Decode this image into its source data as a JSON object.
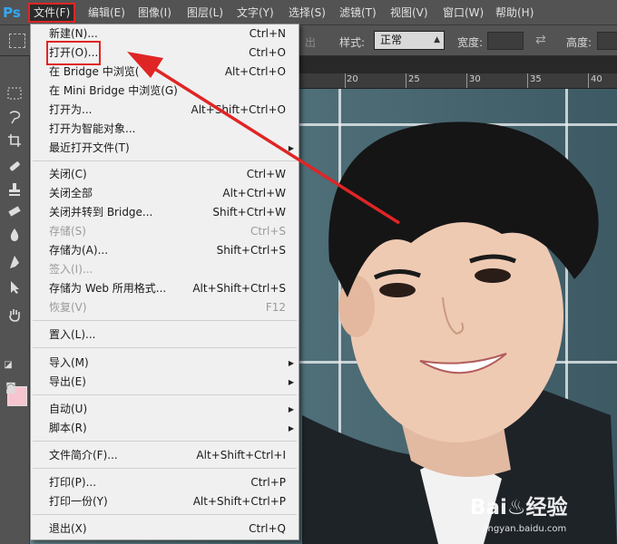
{
  "app": {
    "logo": "Ps"
  },
  "menubar": {
    "items": [
      "文件(F)",
      "编辑(E)",
      "图像(I)",
      "图层(L)",
      "文字(Y)",
      "选择(S)",
      "滤镜(T)",
      "视图(V)",
      "窗口(W)",
      "帮助(H)"
    ],
    "active": "文件(F)"
  },
  "options": {
    "partial_label": "出",
    "style_label": "样式:",
    "style_value": "正常",
    "width_label": "宽度:",
    "height_label": "高度:"
  },
  "ruler": {
    "ticks": [
      "20",
      "25",
      "30",
      "35",
      "40"
    ]
  },
  "file_menu": {
    "items": [
      {
        "label": "新建(N)...",
        "shortcut": "Ctrl+N"
      },
      {
        "label": "打开(O)...",
        "shortcut": "Ctrl+O",
        "highlight": true
      },
      {
        "label": "在 Bridge 中浏览(",
        "shortcut": "Alt+Ctrl+O"
      },
      {
        "label": "在 Mini Bridge 中浏览(G)",
        "shortcut": ""
      },
      {
        "label": "打开为...",
        "shortcut": "Alt+Shift+Ctrl+O"
      },
      {
        "label": "打开为智能对象...",
        "shortcut": ""
      },
      {
        "label": "最近打开文件(T)",
        "shortcut": "",
        "submenu": true
      },
      {
        "label": "关闭(C)",
        "shortcut": "Ctrl+W"
      },
      {
        "label": "关闭全部",
        "shortcut": "Alt+Ctrl+W"
      },
      {
        "label": "关闭并转到 Bridge...",
        "shortcut": "Shift+Ctrl+W"
      },
      {
        "label": "存储(S)",
        "shortcut": "Ctrl+S",
        "disabled": true
      },
      {
        "label": "存储为(A)...",
        "shortcut": "Shift+Ctrl+S"
      },
      {
        "label": "签入(I)...",
        "shortcut": "",
        "disabled": true
      },
      {
        "label": "存储为 Web 所用格式...",
        "shortcut": "Alt+Shift+Ctrl+S"
      },
      {
        "label": "恢复(V)",
        "shortcut": "F12",
        "disabled": true
      },
      {
        "label": "置入(L)...",
        "shortcut": ""
      },
      {
        "label": "导入(M)",
        "shortcut": "",
        "submenu": true
      },
      {
        "label": "导出(E)",
        "shortcut": "",
        "submenu": true
      },
      {
        "label": "自动(U)",
        "shortcut": "",
        "submenu": true
      },
      {
        "label": "脚本(R)",
        "shortcut": "",
        "submenu": true
      },
      {
        "label": "文件简介(F)...",
        "shortcut": "Alt+Shift+Ctrl+I"
      },
      {
        "label": "打印(P)...",
        "shortcut": "Ctrl+P"
      },
      {
        "label": "打印一份(Y)",
        "shortcut": "Alt+Shift+Ctrl+P"
      },
      {
        "label": "退出(X)",
        "shortcut": "Ctrl+Q"
      }
    ]
  },
  "watermark": {
    "logo": "Bai♨经验",
    "sub": "jingyan.baidu.com"
  },
  "colors": {
    "foreground": "#f7c5cf",
    "annotation": "#e02525",
    "ps_blue": "#31a8ff"
  },
  "toolbar_icons": [
    "marquee-icon",
    "lasso-icon",
    "crop-icon",
    "healing-brush-icon",
    "stamp-icon",
    "eraser-icon",
    "blur-icon",
    "pen-icon",
    "path-select-icon",
    "hand-icon"
  ]
}
